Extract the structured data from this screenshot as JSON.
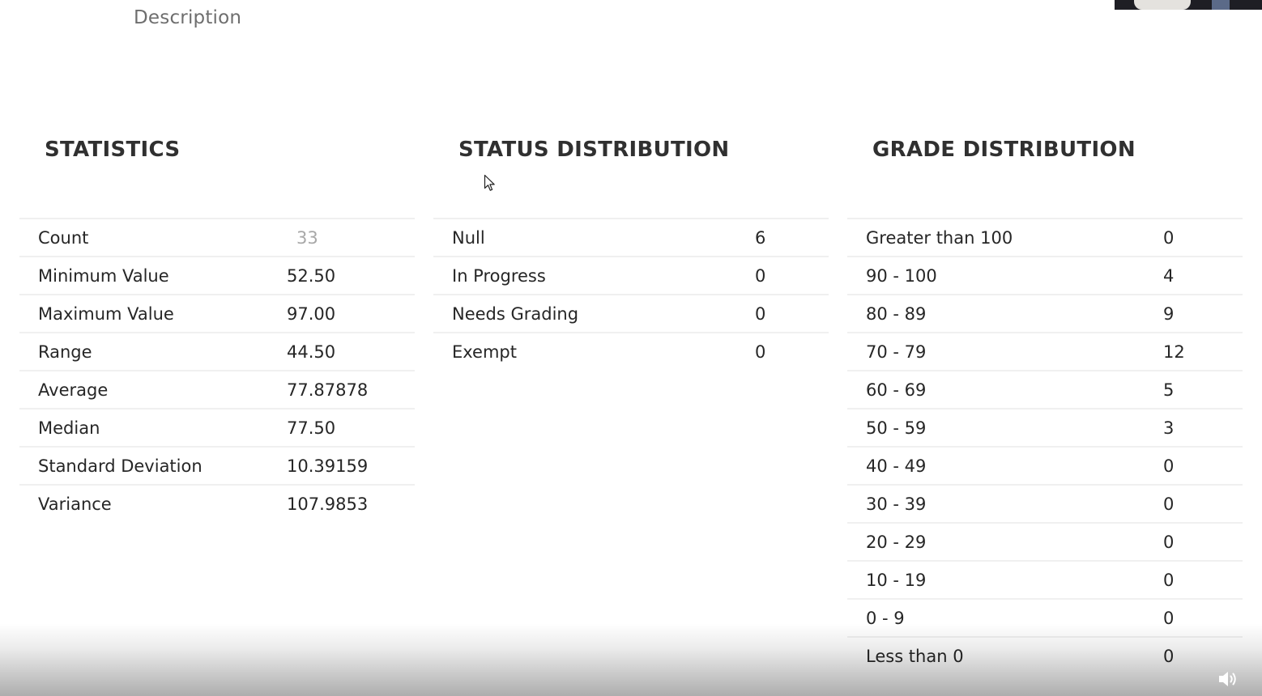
{
  "description_label": "Description",
  "statistics": {
    "title": "STATISTICS",
    "rows": [
      {
        "label": "Count",
        "value": "33"
      },
      {
        "label": "Minimum Value",
        "value": "52.50"
      },
      {
        "label": "Maximum Value",
        "value": "97.00"
      },
      {
        "label": "Range",
        "value": "44.50"
      },
      {
        "label": "Average",
        "value": "77.87878"
      },
      {
        "label": "Median",
        "value": "77.50"
      },
      {
        "label": "Standard Deviation",
        "value": "10.39159"
      },
      {
        "label": "Variance",
        "value": "107.9853"
      }
    ]
  },
  "status_distribution": {
    "title": "STATUS DISTRIBUTION",
    "rows": [
      {
        "label": "Null",
        "value": "6"
      },
      {
        "label": "In Progress",
        "value": "0"
      },
      {
        "label": "Needs Grading",
        "value": "0"
      },
      {
        "label": "Exempt",
        "value": "0"
      }
    ]
  },
  "grade_distribution": {
    "title": "GRADE DISTRIBUTION",
    "rows": [
      {
        "label": "Greater than 100",
        "value": "0"
      },
      {
        "label": "90 - 100",
        "value": "4"
      },
      {
        "label": "80 - 89",
        "value": "9"
      },
      {
        "label": "70 - 79",
        "value": "12"
      },
      {
        "label": "60 - 69",
        "value": "5"
      },
      {
        "label": "50 - 59",
        "value": "3"
      },
      {
        "label": "40 - 49",
        "value": "0"
      },
      {
        "label": "30 - 39",
        "value": "0"
      },
      {
        "label": "20 - 29",
        "value": "0"
      },
      {
        "label": "10 - 19",
        "value": "0"
      },
      {
        "label": "0 - 9",
        "value": "0"
      },
      {
        "label": "Less than 0",
        "value": "0"
      }
    ]
  },
  "icons": {
    "cursor": "mouse-pointer-icon",
    "volume": "volume-icon"
  },
  "colors": {
    "heading": "#303030",
    "text": "#262626",
    "muted": "#a8a8a8",
    "divider": "#f0f0f0"
  }
}
